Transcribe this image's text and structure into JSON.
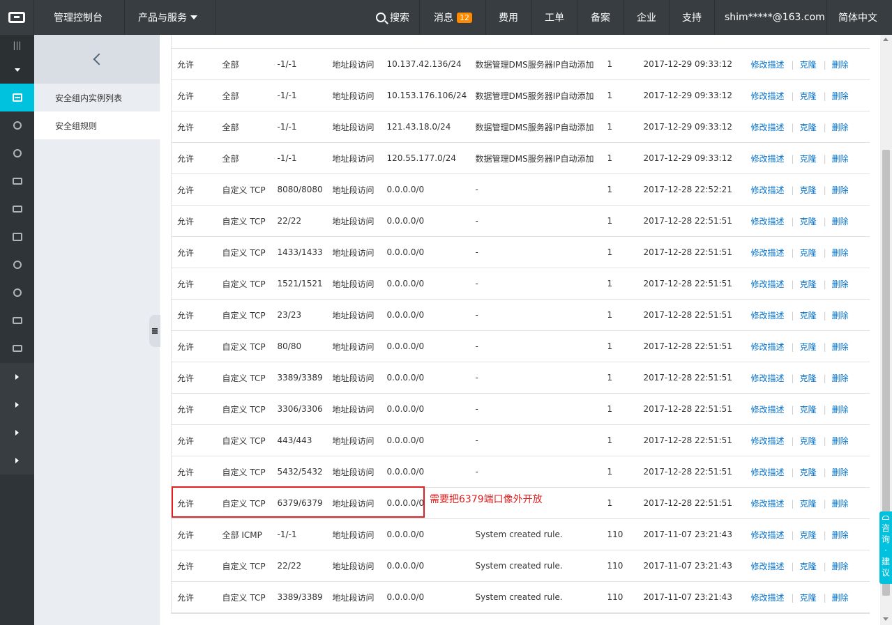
{
  "topbar": {
    "console": "管理控制台",
    "products": "产品与服务",
    "search": "搜索",
    "messages": "消息",
    "message_count": "12",
    "fees": "费用",
    "tickets": "工单",
    "filing": "备案",
    "enterprise": "企业",
    "support": "支持",
    "account": "shim*****@163.com",
    "language": "简体中文"
  },
  "submenu": {
    "items": [
      "安全组内实例列表",
      "安全组规则"
    ]
  },
  "rules": [
    {
      "action": "允许",
      "protocol": "全部",
      "port": "-1/-1",
      "auth": "地址段访问",
      "source": "10.137.42.136/24",
      "desc": "数据管理DMS服务器IP自动添加",
      "priority": "1",
      "time": "2017-12-29 09:33:12"
    },
    {
      "action": "允许",
      "protocol": "全部",
      "port": "-1/-1",
      "auth": "地址段访问",
      "source": "10.153.176.106/24",
      "desc": "数据管理DMS服务器IP自动添加",
      "priority": "1",
      "time": "2017-12-29 09:33:12"
    },
    {
      "action": "允许",
      "protocol": "全部",
      "port": "-1/-1",
      "auth": "地址段访问",
      "source": "121.43.18.0/24",
      "desc": "数据管理DMS服务器IP自动添加",
      "priority": "1",
      "time": "2017-12-29 09:33:12"
    },
    {
      "action": "允许",
      "protocol": "全部",
      "port": "-1/-1",
      "auth": "地址段访问",
      "source": "120.55.177.0/24",
      "desc": "数据管理DMS服务器IP自动添加",
      "priority": "1",
      "time": "2017-12-29 09:33:12"
    },
    {
      "action": "允许",
      "protocol": "自定义 TCP",
      "port": "8080/8080",
      "auth": "地址段访问",
      "source": "0.0.0.0/0",
      "desc": "-",
      "priority": "1",
      "time": "2017-12-28 22:52:21"
    },
    {
      "action": "允许",
      "protocol": "自定义 TCP",
      "port": "22/22",
      "auth": "地址段访问",
      "source": "0.0.0.0/0",
      "desc": "-",
      "priority": "1",
      "time": "2017-12-28 22:51:51"
    },
    {
      "action": "允许",
      "protocol": "自定义 TCP",
      "port": "1433/1433",
      "auth": "地址段访问",
      "source": "0.0.0.0/0",
      "desc": "-",
      "priority": "1",
      "time": "2017-12-28 22:51:51"
    },
    {
      "action": "允许",
      "protocol": "自定义 TCP",
      "port": "1521/1521",
      "auth": "地址段访问",
      "source": "0.0.0.0/0",
      "desc": "-",
      "priority": "1",
      "time": "2017-12-28 22:51:51"
    },
    {
      "action": "允许",
      "protocol": "自定义 TCP",
      "port": "23/23",
      "auth": "地址段访问",
      "source": "0.0.0.0/0",
      "desc": "-",
      "priority": "1",
      "time": "2017-12-28 22:51:51"
    },
    {
      "action": "允许",
      "protocol": "自定义 TCP",
      "port": "80/80",
      "auth": "地址段访问",
      "source": "0.0.0.0/0",
      "desc": "-",
      "priority": "1",
      "time": "2017-12-28 22:51:51"
    },
    {
      "action": "允许",
      "protocol": "自定义 TCP",
      "port": "3389/3389",
      "auth": "地址段访问",
      "source": "0.0.0.0/0",
      "desc": "-",
      "priority": "1",
      "time": "2017-12-28 22:51:51"
    },
    {
      "action": "允许",
      "protocol": "自定义 TCP",
      "port": "3306/3306",
      "auth": "地址段访问",
      "source": "0.0.0.0/0",
      "desc": "-",
      "priority": "1",
      "time": "2017-12-28 22:51:51"
    },
    {
      "action": "允许",
      "protocol": "自定义 TCP",
      "port": "443/443",
      "auth": "地址段访问",
      "source": "0.0.0.0/0",
      "desc": "-",
      "priority": "1",
      "time": "2017-12-28 22:51:51"
    },
    {
      "action": "允许",
      "protocol": "自定义 TCP",
      "port": "5432/5432",
      "auth": "地址段访问",
      "source": "0.0.0.0/0",
      "desc": "-",
      "priority": "1",
      "time": "2017-12-28 22:51:51"
    },
    {
      "action": "允许",
      "protocol": "自定义 TCP",
      "port": "6379/6379",
      "auth": "地址段访问",
      "source": "0.0.0.0/0",
      "desc": "",
      "priority": "1",
      "time": "2017-12-28 22:51:51"
    },
    {
      "action": "允许",
      "protocol": "全部 ICMP",
      "port": "-1/-1",
      "auth": "地址段访问",
      "source": "0.0.0.0/0",
      "desc": "System created rule.",
      "priority": "110",
      "time": "2017-11-07 23:21:43"
    },
    {
      "action": "允许",
      "protocol": "自定义 TCP",
      "port": "22/22",
      "auth": "地址段访问",
      "source": "0.0.0.0/0",
      "desc": "System created rule.",
      "priority": "110",
      "time": "2017-11-07 23:21:43"
    },
    {
      "action": "允许",
      "protocol": "自定义 TCP",
      "port": "3389/3389",
      "auth": "地址段访问",
      "source": "0.0.0.0/0",
      "desc": "System created rule.",
      "priority": "110",
      "time": "2017-11-07 23:21:43"
    }
  ],
  "operations": {
    "edit": "修改描述",
    "clone": "克隆",
    "delete": "删除"
  },
  "annotation": {
    "note": "需要把6379端口像外开放"
  },
  "feedback": {
    "chars": [
      "咨",
      "询",
      "·",
      "建",
      "议"
    ]
  },
  "colors": {
    "topbar": "#373d41",
    "active": "#00c1de",
    "link": "#0070cc",
    "annotation": "#e02020"
  }
}
